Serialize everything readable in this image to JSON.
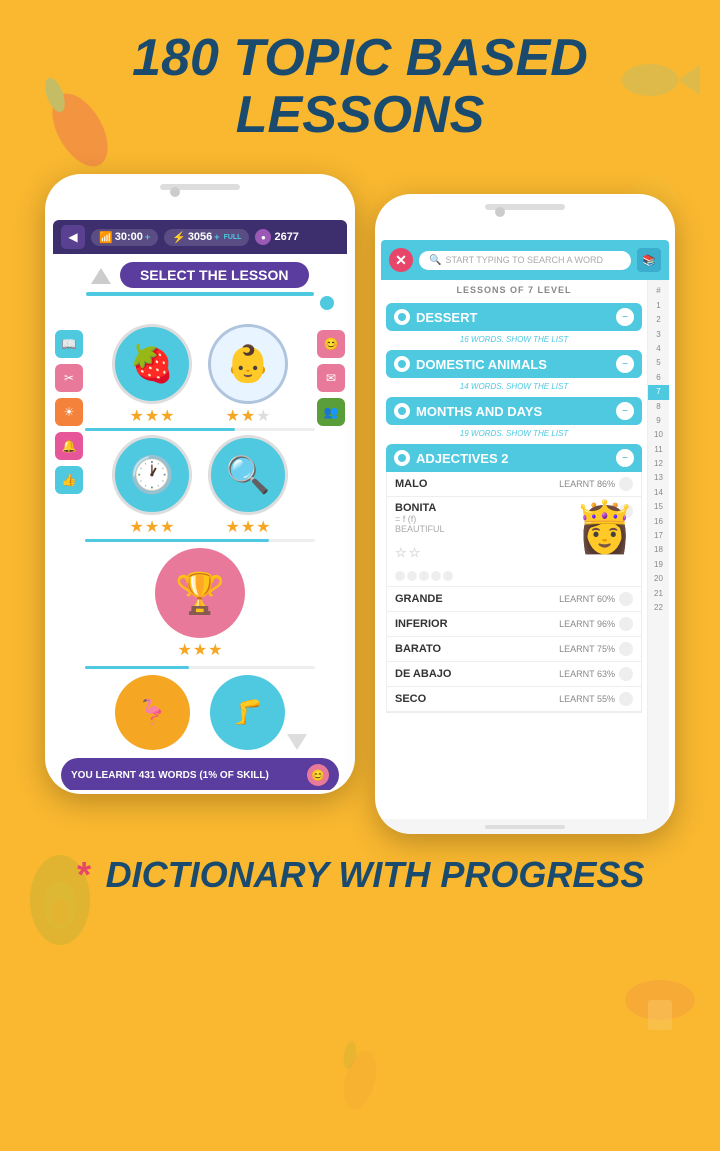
{
  "page": {
    "bg_color": "#F9B830",
    "header_title": "180 TOPIC BASED\nLESSONS",
    "footer_text": "DICTIONARY WITH PROGRESS"
  },
  "phone1": {
    "stats": {
      "timer": "30:00",
      "timer_plus": "+",
      "xp": "3056",
      "xp_label": "FULL",
      "coins": "2677"
    },
    "title": "SELECT THE LESSON",
    "lessons": [
      {
        "icon": "🍓",
        "stars": 3,
        "type": "blue"
      },
      {
        "icon": "👶",
        "stars": 2,
        "type": "light"
      }
    ],
    "lessons2": [
      {
        "icon": "🕐",
        "stars": 3,
        "type": "blue"
      },
      {
        "icon": "🔍",
        "stars": 3,
        "type": "blue"
      }
    ],
    "trophy": {
      "icon": "🏆",
      "stars": 3
    },
    "bottom_lessons": [
      {
        "icon": "🦩",
        "type": "pink"
      },
      {
        "icon": "🦵",
        "type": "blue"
      }
    ],
    "footer_text": "YOU LEARNT 431 WORDS (1% OF SKILL)"
  },
  "phone2": {
    "search_placeholder": "START TYPING TO SEARCH A WORD",
    "level_label": "LESSONS OF 7 LEVEL",
    "lessons": [
      {
        "name": "DESSERT",
        "subtitle": "16 WORDS. SHOW THE LIST"
      },
      {
        "name": "DOMESTIC ANIMALS",
        "subtitle": "14 WORDS. SHOW THE LIST"
      },
      {
        "name": "MONTHS AND DAYS",
        "subtitle": "19 WORDS. SHOW THE LIST"
      }
    ],
    "adjectives_section": "ADJECTIVES 2",
    "words": [
      {
        "word": "MALO",
        "learnt": "LEARNT 86%"
      },
      {
        "word": "BONITA",
        "translation": "= f (f)",
        "sub_translation": "BEAUTIFUL",
        "expanded": true,
        "stars": [
          0,
          0
        ],
        "dots": 5
      },
      {
        "word": "GRANDE",
        "learnt": "LEARNT 60%"
      },
      {
        "word": "INFERIOR",
        "learnt": "LEARNT 96%"
      },
      {
        "word": "BARATO",
        "learnt": "LEARNT 75%"
      },
      {
        "word": "DE ABAJO",
        "learnt": "LEARNT 63%"
      },
      {
        "word": "SECO",
        "learnt": "LEARNT 55%"
      }
    ],
    "sidebar_numbers": [
      "#",
      "1",
      "2",
      "3",
      "4",
      "5",
      "6",
      "7",
      "8",
      "9",
      "10",
      "11",
      "12",
      "13",
      "14",
      "15",
      "16",
      "17",
      "18",
      "19",
      "20",
      "21",
      "22"
    ]
  }
}
